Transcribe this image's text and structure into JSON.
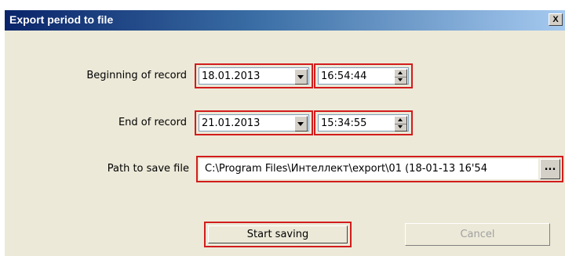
{
  "window": {
    "title": "Export period to file",
    "close_label": "X"
  },
  "begin": {
    "label": "Beginning of record",
    "date": "18.01.2013",
    "time": "16:54:44"
  },
  "end": {
    "label": "End of record",
    "date": "21.01.2013",
    "time": "15:34:55"
  },
  "path": {
    "label": "Path to save file",
    "value": "C:\\Program Files\\Интеллект\\export\\01  (18-01-13 16'54",
    "browse_label": "..."
  },
  "buttons": {
    "start": "Start saving",
    "cancel": "Cancel"
  },
  "colors": {
    "highlight": "#d21c1c",
    "title_bar": "#0a246a",
    "dialog_bg": "#ece9d8"
  }
}
